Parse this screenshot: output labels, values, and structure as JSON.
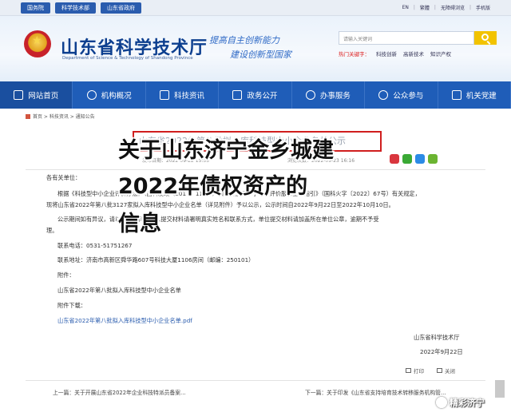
{
  "topbar": {
    "links": [
      "国务院",
      "科学技术部",
      "山东省政府"
    ],
    "right": [
      "EN",
      "繁體",
      "无障碍浏览",
      "手机版"
    ]
  },
  "header": {
    "title": "山东省科学技术厅",
    "subtitle": "Department of Science & Technology of Shandong Province",
    "slogan1": "提高自主创新能力",
    "slogan2": "建设创新型国家"
  },
  "search": {
    "placeholder": "请输入关键词",
    "hot_label": "热门关键字：",
    "hot_words": [
      "科技创新",
      "高新技术",
      "知识产权"
    ]
  },
  "nav": [
    {
      "label": "网站首页",
      "icon": "home-icon"
    },
    {
      "label": "机构概况",
      "icon": "building-icon"
    },
    {
      "label": "科技资讯",
      "icon": "news-icon"
    },
    {
      "label": "政务公开",
      "icon": "layers-icon"
    },
    {
      "label": "办事服务",
      "icon": "person-icon"
    },
    {
      "label": "公众参与",
      "icon": "people-icon"
    },
    {
      "label": "机关党建",
      "icon": "party-icon"
    }
  ],
  "breadcrumb": "首页 > 科技资讯 > 通知公告",
  "article": {
    "ghost_title": "山东省2022年第八批拟入库科技型中小企业名单公示",
    "meta_left": "发布日期：2022-09-22 15:55",
    "meta_right": "浏览次数：2022-09-23 16:16",
    "lines": [
      "各有关单位：",
      "根据《科技型中小企业评价办法》（国科发政〔2017〕115号）和《科技型中小企业评价服务工作指引》（国科火字〔2022〕67号）有关规定，",
      "现将山东省2022年第八批3127家拟入库科技型中小企业名单（详见附件）予以公示，公示时间自2022年9月22日至2022年10月10日。",
      "公示期间如有异议，请以书面材料，个人提交材料请署明真实姓名和联系方式，单位提交材料请加盖所在单位公章，逾期不予受",
      "理。",
      "联系电话：0531-51751267",
      "联系地址：济南市高新区舜华路607号科技大厦1106房间（邮编：250101）",
      "附件：",
      "山东省2022年第八批拟入库科技型中小企业名单",
      "附件下载：",
      "山东省2022年第八批拟入库科技型中小企业名单.pdf"
    ],
    "signature": "山东省科学技术厅",
    "date": "2022年9月22日"
  },
  "overlay": {
    "line1": "关于山东济宁金乡城建",
    "line2": "2022年债权资产的",
    "line3": "信息"
  },
  "tools": {
    "print": "打印",
    "close": "关闭"
  },
  "pager": {
    "prev": "上一篇：关于开展山东省2022年企业科技特派员备案...",
    "next": "下一篇：关于印发《山东省支持培育技术转移服务机构管..."
  },
  "watermark": "精彩济宁"
}
